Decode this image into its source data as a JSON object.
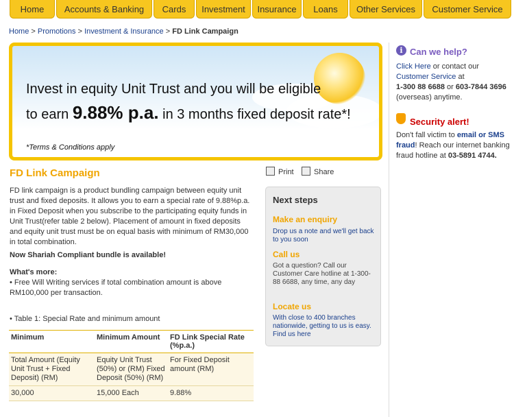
{
  "nav": {
    "items": [
      "Home",
      "Accounts & Banking",
      "Cards",
      "Investment",
      "Insurance",
      "Loans",
      "Other Services",
      "Customer Service"
    ]
  },
  "breadcrumb": {
    "home": "Home",
    "promotions": "Promotions",
    "invest": "Investment & Insurance",
    "sep": ">",
    "current": "FD Link Campaign"
  },
  "banner": {
    "line1": "Invest in equity Unit Trust and you will be eligible",
    "line2_pre": "to earn",
    "line2_rate": "9.88% p.a.",
    "line2_post": "in 3 months fixed deposit rate*!",
    "tc": "*Terms & Conditions apply"
  },
  "main": {
    "title": "FD Link Campaign",
    "print": "Print",
    "share": "Share",
    "intro": "FD link campaign is a product bundling campaign between equity unit trust and fixed deposits. It allows you to earn a special rate of 9.88%p.a. in Fixed Deposit when you subscribe to the participating equity funds in Unit Trust(refer table 2 below). Placement of amount in fixed deposits and equity unit trust must be on equal basis with minimum of RM30,000 in total combination.",
    "shariah": "Now Shariah Compliant bundle is available!",
    "whats_more": "What's more:",
    "whats_more_item": "• Free Will Writing services if total combination amount is above RM100,000 per transaction.",
    "table_caption": "• Table 1: Special Rate and minimum amount"
  },
  "table": {
    "headers": [
      "Minimum",
      "Minimum Amount",
      "FD Link Special Rate (%p.a.)"
    ],
    "rows": [
      [
        "Total Amount (Equity Unit Trust + Fixed Deposit) (RM)",
        "Equity Unit Trust (50%) or (RM) Fixed Deposit (50%) (RM)",
        "For Fixed Deposit amount (RM)"
      ],
      [
        "30,000",
        "15,000 Each",
        "9.88%"
      ]
    ]
  },
  "next_steps": {
    "title": "Next steps",
    "enquiry_title": "Make an enquiry",
    "enquiry_text": "Drop us a note and we'll get back to you soon",
    "call_title": "Call us",
    "call_text": "Got a question? Call our Customer Care hotline at 1-300-88 6688, any time, any day",
    "locate_title": "Locate us",
    "locate_text": "With close to 400 branches nationwide, getting to us is easy. Find us here"
  },
  "sidebar": {
    "help_title": "Can we help?",
    "help_click": "Click Here",
    "help_text1": "or contact our",
    "help_cs": "Customer Service",
    "help_text2": "at",
    "help_phone1": "1-300 88 6688",
    "help_or": "or",
    "help_phone2": "603-7844 3696",
    "help_overseas": "(overseas) anytime.",
    "sec_title": "Security alert!",
    "sec_text1": "Don't fall victim to",
    "sec_link": "email or SMS fraud",
    "sec_text2": "! Reach our internet banking fraud hotline at",
    "sec_phone": "03-5891 4744."
  },
  "colors": {
    "nav": "#f7c61f",
    "accent": "#f0a500",
    "link": "#1a3f8c",
    "alert": "#cc0000",
    "help": "#7a5cbf"
  }
}
